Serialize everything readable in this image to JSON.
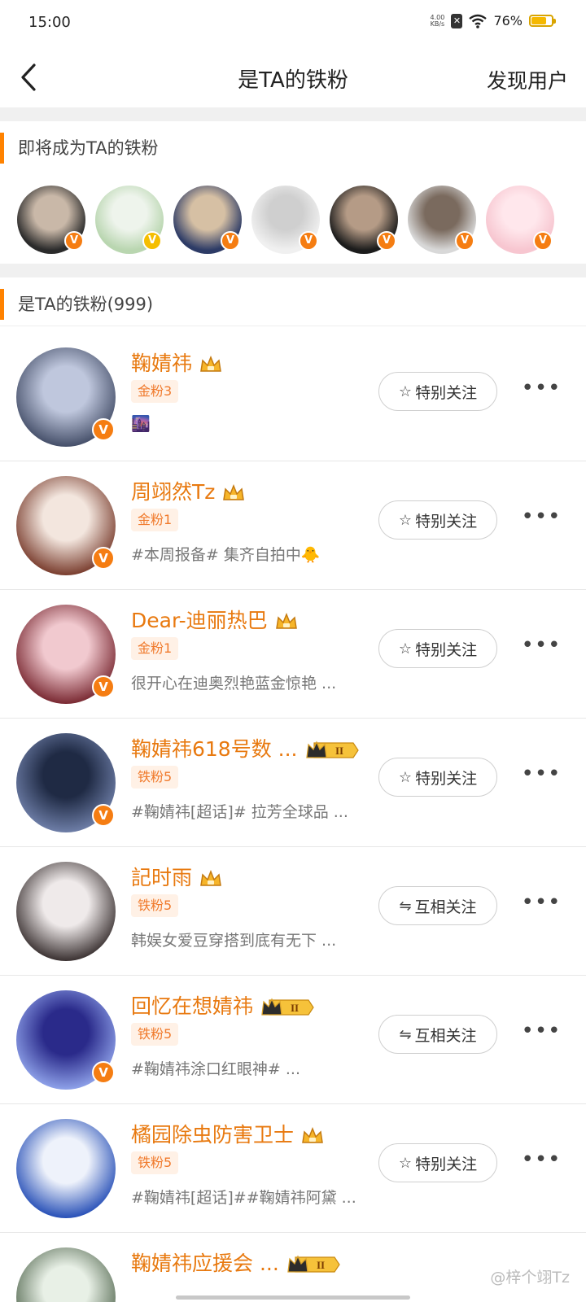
{
  "status": {
    "time": "15:00",
    "speed_top": "4.00",
    "speed_bottom": "KB/s",
    "battery": "76%",
    "battery_level": 0.76
  },
  "nav": {
    "title": "是TA的铁粉",
    "right": "发现用户"
  },
  "upcoming": {
    "title": "即将成为TA的铁粉",
    "avatars": [
      {
        "colors": [
          "#2b2b2b",
          "#c9b8a8"
        ],
        "badge": "orange"
      },
      {
        "colors": [
          "#b9d6b0",
          "#eef4ec"
        ],
        "badge": "yellow"
      },
      {
        "colors": [
          "#2d3b66",
          "#d6c0a4"
        ],
        "badge": "orange"
      },
      {
        "colors": [
          "#f0f0f0",
          "#cfcfcf"
        ],
        "badge": "orange"
      },
      {
        "colors": [
          "#1c1c1c",
          "#b59b86"
        ],
        "badge": "orange"
      },
      {
        "colors": [
          "#d8d8d8",
          "#7a6a5e"
        ],
        "badge": "orange"
      },
      {
        "colors": [
          "#f7c6d0",
          "#ffe7ec"
        ],
        "badge": "orange"
      }
    ]
  },
  "fans": {
    "title": "是TA的铁粉(999)",
    "items": [
      {
        "name": "鞠婧祎",
        "tag": "金粉3",
        "desc": "🌆",
        "button_icon": "☆",
        "button": "特别关注",
        "crown": "plain",
        "verified": true,
        "avatar": [
          "#bfc7dd",
          "#46506a"
        ]
      },
      {
        "name": "周翊然Tz",
        "tag": "金粉1",
        "desc": "#本周报备# 集齐自拍中🐥",
        "button_icon": "☆",
        "button": "特别关注",
        "crown": "plain",
        "verified": true,
        "avatar": [
          "#f3e6de",
          "#7b3f30"
        ]
      },
      {
        "name": "Dear-迪丽热巴",
        "tag": "金粉1",
        "desc": "很开心在迪奥烈艳蓝金惊艳 ...",
        "button_icon": "☆",
        "button": "特别关注",
        "crown": "plain",
        "verified": true,
        "avatar": [
          "#f1c9cf",
          "#7b2b34"
        ]
      },
      {
        "name": "鞠婧祎618号数 ...",
        "tag": "铁粉5",
        "desc": "#鞠婧祎[超话]# 拉芳全球品 ...",
        "button_icon": "☆",
        "button": "特别关注",
        "crown": "pill",
        "pill_text": "II",
        "verified": true,
        "avatar": [
          "#1f2a44",
          "#6d7da6"
        ]
      },
      {
        "name": "記时雨",
        "tag": "铁粉5",
        "desc": "韩娱女爱豆穿搭到底有无下 ...",
        "button_icon": "⇋",
        "button": "互相关注",
        "crown": "plain",
        "verified": false,
        "avatar": [
          "#efeaea",
          "#3d3434"
        ]
      },
      {
        "name": "回忆在想婧祎",
        "tag": "铁粉5",
        "desc": "#鞠婧祎涂口红眼神# ...",
        "button_icon": "⇋",
        "button": "互相关注",
        "crown": "pill",
        "pill_text": "II",
        "verified": true,
        "avatar": [
          "#2a2a8a",
          "#8da0e8"
        ]
      },
      {
        "name": "橘园除虫防害卫士",
        "tag": "铁粉5",
        "desc": "#鞠婧祎[超话]##鞠婧祎阿黛 ...",
        "button_icon": "☆",
        "button": "特别关注",
        "crown": "plain",
        "verified": false,
        "avatar": [
          "#eef2fb",
          "#2a52b8"
        ]
      },
      {
        "name": "鞠婧祎应援会 ...",
        "tag": "",
        "desc": "",
        "button_icon": "",
        "button": "",
        "crown": "pill",
        "pill_text": "II",
        "verified": false,
        "avatar": [
          "#e8f0e6",
          "#5b6f58"
        ]
      }
    ]
  },
  "watermark": "@梓个翊Tz",
  "colors": {
    "accent": "#ff8200",
    "name": "#e8790f",
    "badge": "#f57d12"
  }
}
